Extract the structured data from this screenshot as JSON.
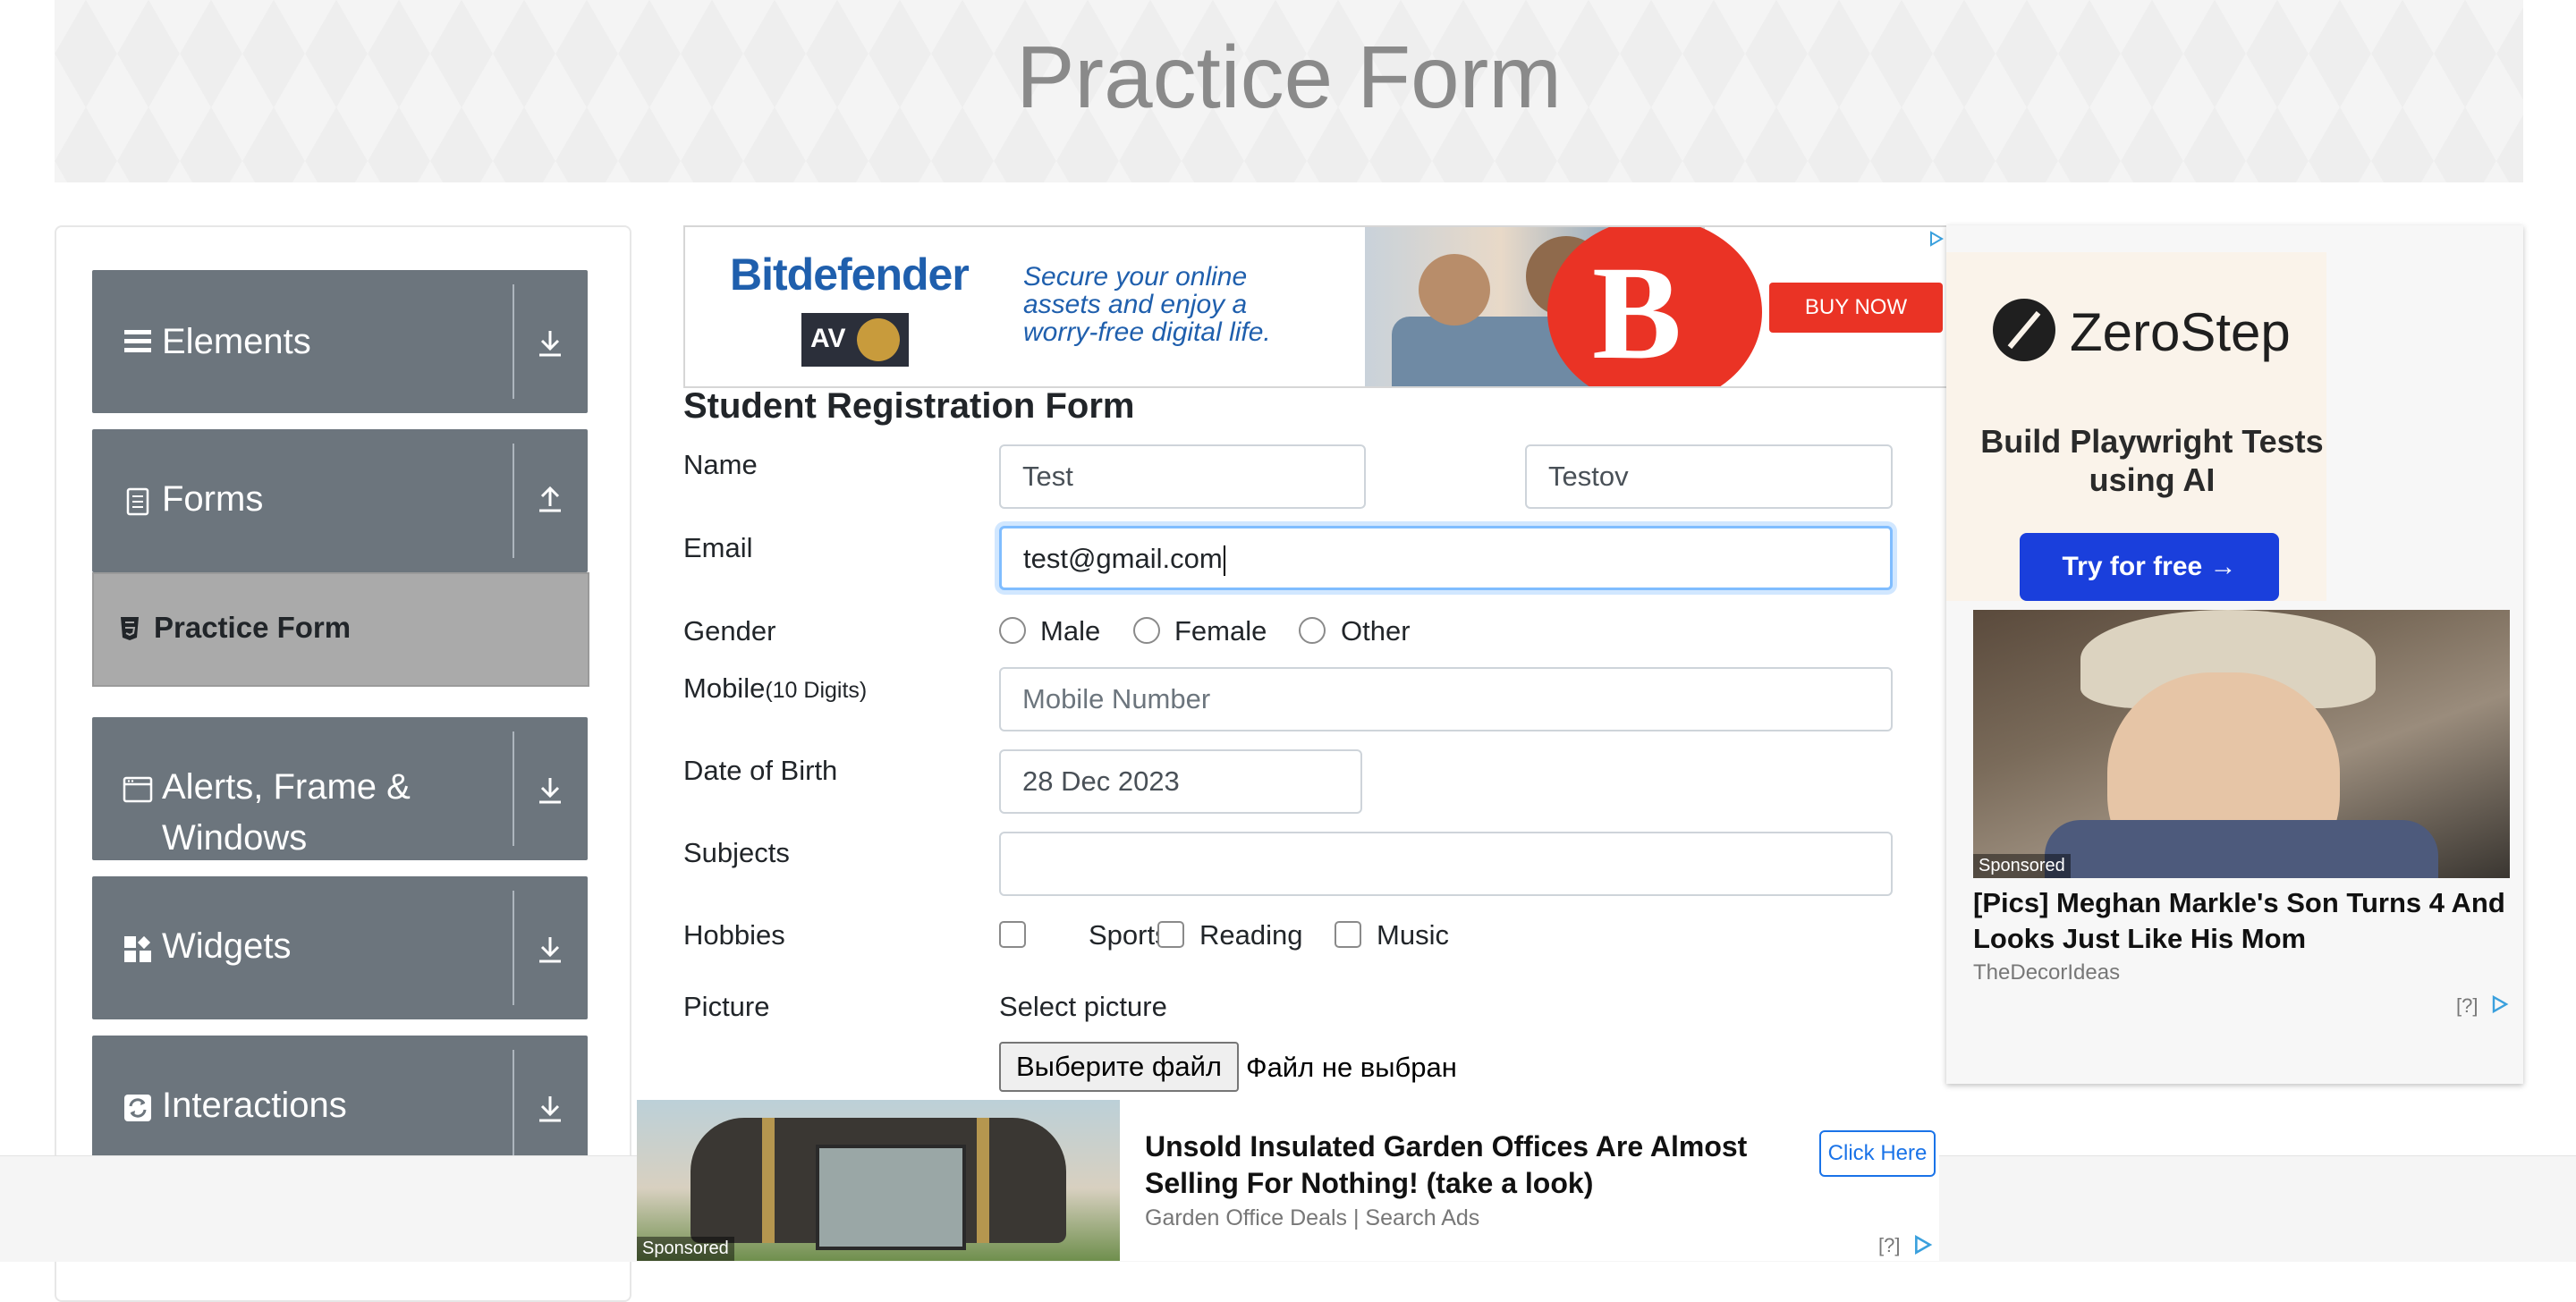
{
  "banner": {
    "title": "Practice Form"
  },
  "sidebar": {
    "groups": [
      {
        "label": "Elements",
        "icon": "list-icon",
        "arrow": "download-icon"
      },
      {
        "label": "Forms",
        "icon": "document-icon",
        "arrow": "upload-icon",
        "items": [
          {
            "label": "Practice Form",
            "icon": "html5-icon",
            "active": true
          }
        ]
      },
      {
        "label": "Alerts, Frame & Windows",
        "icon": "window-icon",
        "arrow": "download-icon"
      },
      {
        "label": "Widgets",
        "icon": "widgets-icon",
        "arrow": "download-icon"
      },
      {
        "label": "Interactions",
        "icon": "refresh-icon",
        "arrow": "download-icon"
      }
    ]
  },
  "top_ad": {
    "brand": "Bitdefender",
    "badge": "AV",
    "tagline": "Secure your online assets and enjoy a worry-free digital life.",
    "logo_letter": "B",
    "cta": "BUY NOW"
  },
  "form": {
    "title": "Student Registration Form",
    "name": {
      "label": "Name",
      "first": "Test",
      "last": "Testov"
    },
    "email": {
      "label": "Email",
      "value": "test@gmail.com"
    },
    "gender": {
      "label": "Gender",
      "options": [
        "Male",
        "Female",
        "Other"
      ]
    },
    "mobile": {
      "label": "Mobile",
      "hint": "(10 Digits)",
      "placeholder": "Mobile Number"
    },
    "dob": {
      "label": "Date of Birth",
      "value": "28 Dec 2023"
    },
    "subjects": {
      "label": "Subjects",
      "value": ""
    },
    "hobbies": {
      "label": "Hobbies",
      "options": [
        "Sports",
        "Reading",
        "Music"
      ]
    },
    "picture": {
      "label": "Picture",
      "select_label": "Select picture",
      "button": "Выберите файл",
      "status": "Файл не выбран"
    }
  },
  "right_ad": {
    "brand": "ZeroStep",
    "tagline": "Build Playwright Tests using AI",
    "cta": "Try for free →",
    "sponsored": "Sponsored",
    "headline": "[Pics] Meghan Markle's Son Turns 4 And Looks Just Like His Mom",
    "source": "TheDecorIdeas",
    "question": "[?]"
  },
  "bottom_ad": {
    "sponsored": "Sponsored",
    "headline": "Unsold Insulated Garden Offices Are Almost Selling For Nothing! (take a look)",
    "source": "Garden Office Deals | Search Ads",
    "cta": "Click Here",
    "question": "[?]"
  },
  "colors": {
    "sidebar_group": "#6c757d",
    "active_item": "#aaaaaa",
    "focus_ring": "#80bdff",
    "bitdefender_red": "#ea3325",
    "zerostep_blue": "#1a3fdc"
  }
}
